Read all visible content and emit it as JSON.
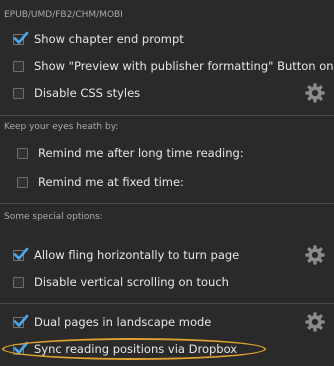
{
  "sections": [
    {
      "header": "EPUB/UMD/FB2/CHM/MOBI",
      "items": [
        {
          "label": "Show chapter end prompt",
          "checked": true
        },
        {
          "label": "Show \"Preview with publisher formatting\" Button on top bar",
          "checked": false
        },
        {
          "label": "Disable CSS styles",
          "checked": false,
          "gear": "gear-icon"
        }
      ]
    },
    {
      "header": "Keep your eyes heath by:",
      "items": [
        {
          "label": "Remind me after long time reading:",
          "checked": false
        },
        {
          "label": "Remind me at fixed time:",
          "checked": false
        }
      ]
    },
    {
      "header": "Some special options:",
      "items": [
        {
          "label": "Allow fling horizontally to turn page",
          "checked": true,
          "gear": "gear-icon"
        },
        {
          "label": "Disable vertical scrolling on touch",
          "checked": false
        }
      ]
    },
    {
      "header": "",
      "items": [
        {
          "label": "Dual pages in landscape mode",
          "checked": true,
          "gear": "gear-icon"
        },
        {
          "label": "Sync reading positions via Dropbox",
          "checked": true
        }
      ]
    }
  ],
  "colors": {
    "background": "#2a2a2a",
    "check": "#4aa8f0",
    "highlight": "#e0a030",
    "gear": "#8c8c8c"
  }
}
